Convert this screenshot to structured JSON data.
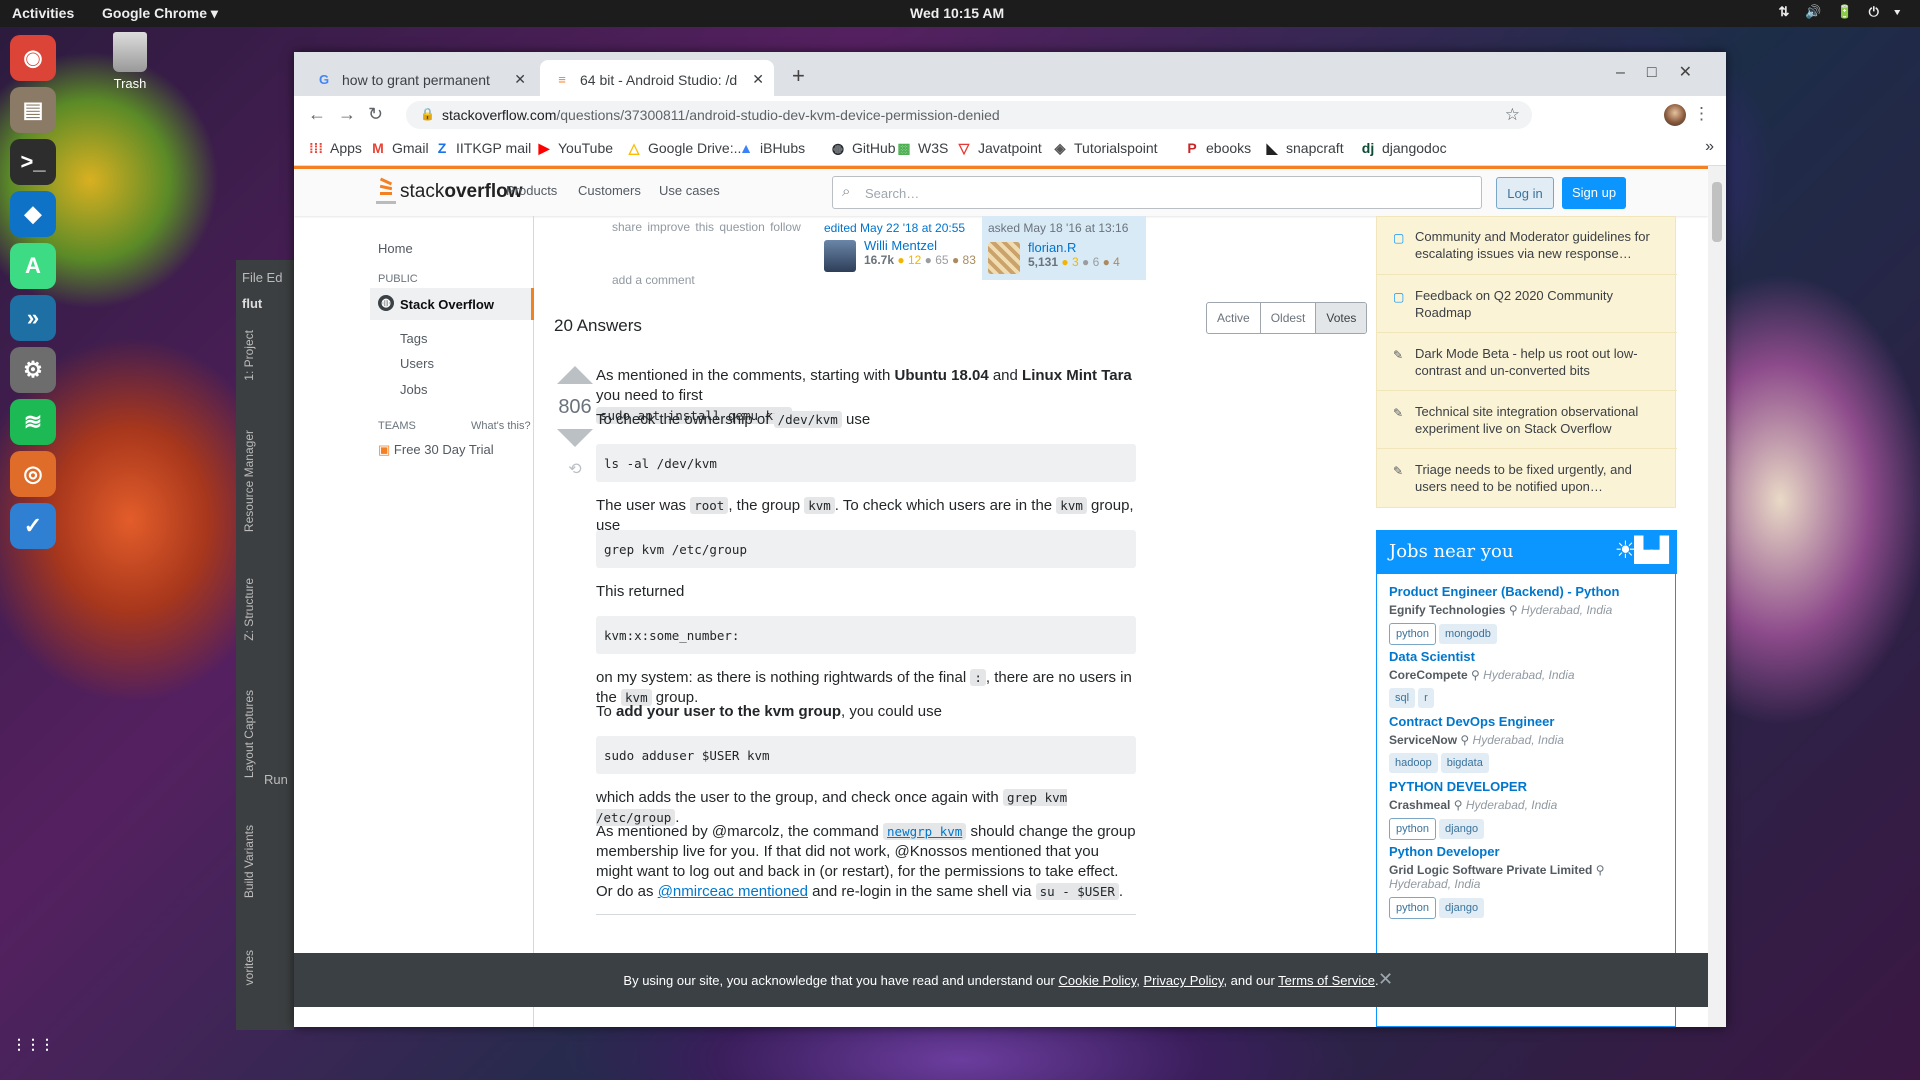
{
  "desktop": {
    "activities": "Activities",
    "app_menu": "Google Chrome ▾",
    "clock": "Wed 10:15 AM",
    "tray": "⇅ 🔊 🔋 ⏻ ▾",
    "trash_label": "Trash"
  },
  "dock": {
    "apps": [
      {
        "name": "chrome-icon",
        "glyph": "◉",
        "color": "#db4437"
      },
      {
        "name": "files-icon",
        "glyph": "▤",
        "color": "#8a7a66"
      },
      {
        "name": "terminal-icon",
        "glyph": ">_",
        "color": "#2d2d2d"
      },
      {
        "name": "vscode-icon",
        "glyph": "◆",
        "color": "#0e72c6"
      },
      {
        "name": "android-studio-icon",
        "glyph": "A",
        "color": "#3ddc84"
      },
      {
        "name": "remote-icon",
        "glyph": "»",
        "color": "#1e6fa3"
      },
      {
        "name": "settings-icon",
        "glyph": "⚙",
        "color": "#6d6d6d"
      },
      {
        "name": "spotify-icon",
        "glyph": "≋",
        "color": "#1db954"
      },
      {
        "name": "screenshot-icon",
        "glyph": "◎",
        "color": "#e06c2a"
      },
      {
        "name": "todo-icon",
        "glyph": "✓",
        "color": "#2f7fd3"
      }
    ],
    "show_apps": "⋮⋮⋮"
  },
  "ide": {
    "menu": "File  Ed",
    "project_tab": "1: Project",
    "resource_tab": "Resource Manager",
    "structure_tab": "Z: Structure",
    "layout_tab": "Layout Captures",
    "variants_tab": "Build Variants",
    "favorites_tab": "vorites",
    "run": "Run",
    "flut": "flut"
  },
  "browser": {
    "tabs": [
      {
        "title": "how to grant permanent",
        "fav": "G",
        "fav_color": "#4285f4"
      },
      {
        "title": "64 bit - Android Studio: /d",
        "fav": "≡",
        "fav_color": "#f48024"
      }
    ],
    "new_tab": "+",
    "window_controls": "–□✕",
    "url_host": "stackoverflow.com",
    "url_path": "/questions/37300811/android-studio-dev-kvm-device-permission-denied",
    "bookmarks": [
      {
        "label": "Apps",
        "icon": "⁞⁞⁞",
        "color": "#ea4335"
      },
      {
        "label": "Gmail",
        "icon": "M",
        "color": "#ea4335"
      },
      {
        "label": "IITKGP mail",
        "icon": "Z",
        "color": "#1a73e8"
      },
      {
        "label": "YouTube",
        "icon": "▶",
        "color": "#ff0000"
      },
      {
        "label": "Google Drive:...",
        "icon": "△",
        "color": "#fbbc04"
      },
      {
        "label": "iBHubs",
        "icon": "▲",
        "color": "#3b82f6"
      },
      {
        "label": "GitHub",
        "icon": "◍",
        "color": "#24292e"
      },
      {
        "label": "W3S",
        "icon": "▩",
        "color": "#4caf50"
      },
      {
        "label": "Javatpoint",
        "icon": "▽",
        "color": "#e53935"
      },
      {
        "label": "Tutorialspoint",
        "icon": "◈",
        "color": "#555555"
      },
      {
        "label": "ebooks",
        "icon": "P",
        "color": "#c62828"
      },
      {
        "label": "snapcraft",
        "icon": "◣",
        "color": "#222222"
      },
      {
        "label": "djangodoc",
        "icon": "dj",
        "color": "#0c4b33"
      }
    ],
    "bookmarks_more": "»"
  },
  "so": {
    "logo_a": "stack",
    "logo_b": "overflow",
    "nav": [
      "Products",
      "Customers",
      "Use cases"
    ],
    "search_placeholder": "Search…",
    "login": "Log in",
    "signup": "Sign up",
    "leftnav": {
      "home": "Home",
      "public": "PUBLIC",
      "stackoverflow": "Stack Overflow",
      "tags": "Tags",
      "users": "Users",
      "jobs": "Jobs",
      "teams": "TEAMS",
      "whats_this": "What's this?",
      "trial": "Free 30 Day Trial"
    },
    "question_actions": "share   improve this question   follow",
    "add_comment": "add a comment",
    "editor": {
      "label": "edited May 22 '18 at 20:55",
      "name": "Willi Mentzel",
      "rep": "16.7k",
      "gold": "● 12",
      "silver": "● 65",
      "bronze": "● 83"
    },
    "asker": {
      "label": "asked May 18 '16 at 13:16",
      "name": "florian.R",
      "rep": "5,131",
      "gold": "● 3",
      "silver": "● 6",
      "bronze": "● 4"
    },
    "answers_header": "20 Answers",
    "sort": [
      "Active",
      "Oldest",
      "Votes"
    ],
    "vote_count": "806",
    "answer": {
      "p1a": "As mentioned in the comments, starting with ",
      "p1b": "Ubuntu 18.04",
      "p1c": " and ",
      "p1d": "Linux Mint Tara",
      "p1e": " you need to first",
      "p1code": "sudo apt install qemu-kvm",
      "p1f": ".",
      "p2a": "To check the ownership of ",
      "p2code": "/dev/kvm",
      "p2b": " use",
      "pre1": "ls -al /dev/kvm",
      "p3a": "The user was ",
      "p3code1": "root",
      "p3b": ", the group ",
      "p3code2": "kvm",
      "p3c": ". To check which users are in the ",
      "p3code3": "kvm",
      "p3d": " group, use",
      "pre2": "grep kvm /etc/group",
      "p4": "This returned",
      "pre3": "kvm:x:some_number:",
      "p5a": "on my system: as there is nothing rightwards of the final ",
      "p5code1": ":",
      "p5b": ", there are no users in the ",
      "p5code2": "kvm",
      "p5c": " group.",
      "p6a": "To ",
      "p6b": "add your user to the kvm group",
      "p6c": ", you could use",
      "pre4": "sudo adduser $USER kvm",
      "p7a": "which adds the user to the group, and check once again with ",
      "p7code": "grep kvm /etc/group",
      "p7b": ".",
      "p8a": "As mentioned by @marcolz, the command ",
      "p8code": "newgrp kvm",
      "p8b": " should change the group membership live for you. If that did not work, @Knossos mentioned that you might want to log out and back in (or restart), for the permissions to take effect. Or do as ",
      "p8link": "@nmirceac mentioned",
      "p8c": " and re-login in the same shell via ",
      "p8code2": "su - $USER",
      "p8d": "."
    },
    "blog": [
      {
        "icon": "▢",
        "text": "Community and Moderator guidelines for escalating issues via new response…"
      },
      {
        "icon": "▢",
        "text": "Feedback on Q2 2020 Community Roadmap"
      },
      {
        "icon": "✎",
        "text": "Dark Mode Beta - help us root out low-contrast and un-converted bits"
      },
      {
        "icon": "✎",
        "text": "Technical site integration observational experiment live on Stack Overflow"
      },
      {
        "icon": "✎",
        "text": "Triage needs to be fixed urgently, and users need to be notified upon…"
      }
    ],
    "jobs_title": "Jobs near you",
    "jobs": [
      {
        "title": "Product Engineer (Backend) - Python",
        "company": "Egnify Technologies",
        "loc": "Hyderabad, India",
        "tags": [
          "python",
          "mongodb"
        ]
      },
      {
        "title": "Data Scientist",
        "company": "CoreCompete",
        "loc": "Hyderabad, India",
        "tags": [
          "sql",
          "r"
        ]
      },
      {
        "title": "Contract DevOps Engineer",
        "company": "ServiceNow",
        "loc": "Hyderabad, India",
        "tags": [
          "hadoop",
          "bigdata"
        ]
      },
      {
        "title": "PYTHON DEVELOPER",
        "company": "Crashmeal",
        "loc": "Hyderabad, India",
        "tags": [
          "python",
          "django"
        ]
      },
      {
        "title": "Python Developer",
        "company": "Grid Logic Software Private Limited",
        "loc": "Hyderabad, India",
        "tags": [
          "python",
          "django"
        ]
      }
    ],
    "cookie": {
      "a": "By using our site, you acknowledge that you have read and understand our ",
      "cookie_policy": "Cookie Policy",
      "b": ", ",
      "privacy": "Privacy Policy",
      "c": ", and our ",
      "terms": "Terms of Service",
      "d": ".",
      "close": "✕"
    }
  }
}
